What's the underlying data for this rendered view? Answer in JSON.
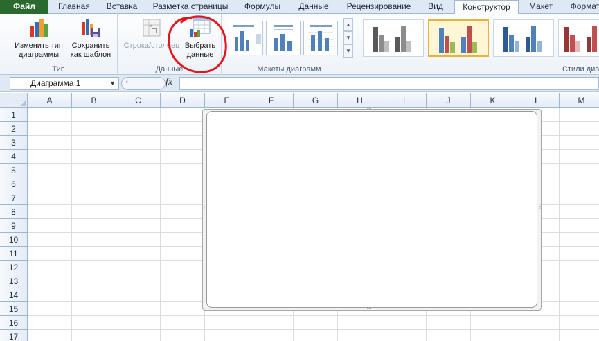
{
  "tabs": [
    {
      "label": "Файл",
      "kind": "file"
    },
    {
      "label": "Главная"
    },
    {
      "label": "Вставка"
    },
    {
      "label": "Разметка страницы"
    },
    {
      "label": "Формулы"
    },
    {
      "label": "Данные"
    },
    {
      "label": "Рецензирование"
    },
    {
      "label": "Вид"
    },
    {
      "label": "Конструктор",
      "active": true
    },
    {
      "label": "Макет"
    },
    {
      "label": "Формат"
    }
  ],
  "ribbon": {
    "groups": {
      "type": "Тип",
      "data": "Данные",
      "layouts": "Макеты диаграмм",
      "styles": "Стили диаграмм"
    },
    "buttons": {
      "change_type": "Изменить тип диаграммы",
      "save_template": "Сохранить как шаблон",
      "row_column": "Строка/столбец",
      "select_data": "Выбрать данные"
    },
    "annotation_color": "#e8141b"
  },
  "formula_bar": {
    "name_box": "Диаграмма 1",
    "fx": "fx",
    "value": ""
  },
  "sheet": {
    "columns": [
      "A",
      "B",
      "C",
      "D",
      "E",
      "F",
      "G",
      "H",
      "I",
      "J",
      "K",
      "L",
      "M"
    ],
    "rows": [
      "1",
      "2",
      "3",
      "4",
      "5",
      "6",
      "7",
      "8",
      "9",
      "10",
      "11",
      "12",
      "13",
      "14",
      "15",
      "16",
      "17"
    ]
  },
  "chart": {
    "name": "Диаграмма 1",
    "empty": true
  }
}
